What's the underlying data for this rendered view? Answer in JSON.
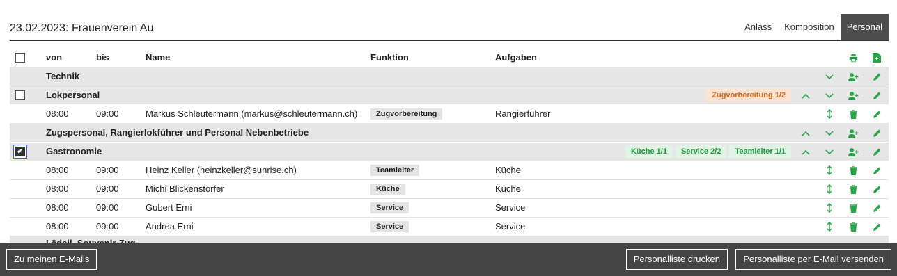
{
  "header": {
    "title": "23.02.2023: Frauenverein Au"
  },
  "tabs": [
    {
      "label": "Anlass"
    },
    {
      "label": "Komposition"
    },
    {
      "label": "Personal"
    }
  ],
  "columns": {
    "von": "von",
    "bis": "bis",
    "name": "Name",
    "funktion": "Funktion",
    "aufgaben": "Aufgaben"
  },
  "groups": {
    "technik": {
      "title": "Technik"
    },
    "lokpersonal": {
      "title": "Lokpersonal",
      "pills": [
        "Zugvorbereitung 1/2"
      ],
      "rows": [
        {
          "von": "08:00",
          "bis": "09:00",
          "name": "Markus Schleutermann (markus@schleutermann.ch)",
          "funktion": "Zugvorbereitung",
          "aufgabe": "Rangierführer"
        }
      ]
    },
    "zugspersonal": {
      "title": "Zugspersonal, Rangierlokführer und Personal Nebenbetriebe"
    },
    "gastronomie": {
      "title": "Gastronomie",
      "pills": [
        "Küche 1/1",
        "Service 2/2",
        "Teamleiter 1/1"
      ],
      "rows": [
        {
          "von": "08:00",
          "bis": "09:00",
          "name": "Heinz Keller (heinzkeller@sunrise.ch)",
          "funktion": "Teamleiter",
          "aufgabe": "Küche"
        },
        {
          "von": "08:00",
          "bis": "09:00",
          "name": "Michi Blickenstorfer",
          "funktion": "Küche",
          "aufgabe": "Küche"
        },
        {
          "von": "08:00",
          "bis": "09:00",
          "name": "Gubert Erni",
          "funktion": "Service",
          "aufgabe": "Service"
        },
        {
          "von": "08:00",
          "bis": "09:00",
          "name": "Andrea Erni",
          "funktion": "Service",
          "aufgabe": "Service"
        }
      ]
    },
    "partial": {
      "title": "Lädeli, Souvenir-Zug"
    }
  },
  "footer": {
    "emails": "Zu meinen E-Mails",
    "print": "Personalliste drucken",
    "send": "Personalliste per E-Mail versenden"
  },
  "colors": {
    "accent": "#2aa44a",
    "warn": "#d2691e",
    "footer": "#444444"
  }
}
